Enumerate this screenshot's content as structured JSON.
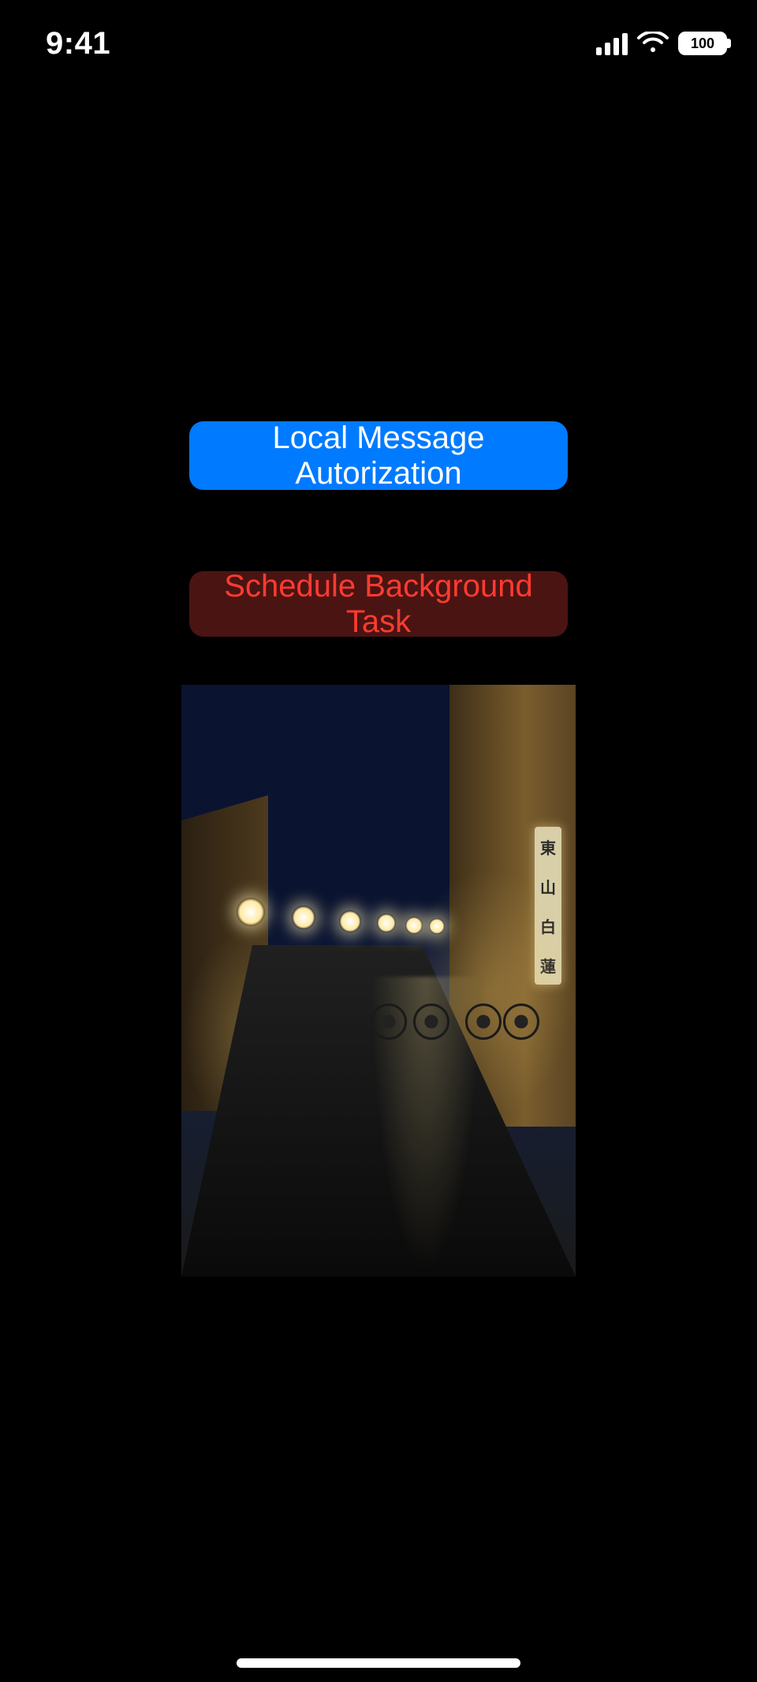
{
  "status_bar": {
    "time": "9:41",
    "battery_percent": "100"
  },
  "buttons": {
    "primary_label": "Local Message Autorization",
    "secondary_label": "Schedule Background Task"
  },
  "image": {
    "description": "night-street-photo"
  },
  "colors": {
    "primary": "#007AFF",
    "danger_text": "#ff3b30",
    "danger_bg": "#4a1413",
    "background": "#000000"
  }
}
